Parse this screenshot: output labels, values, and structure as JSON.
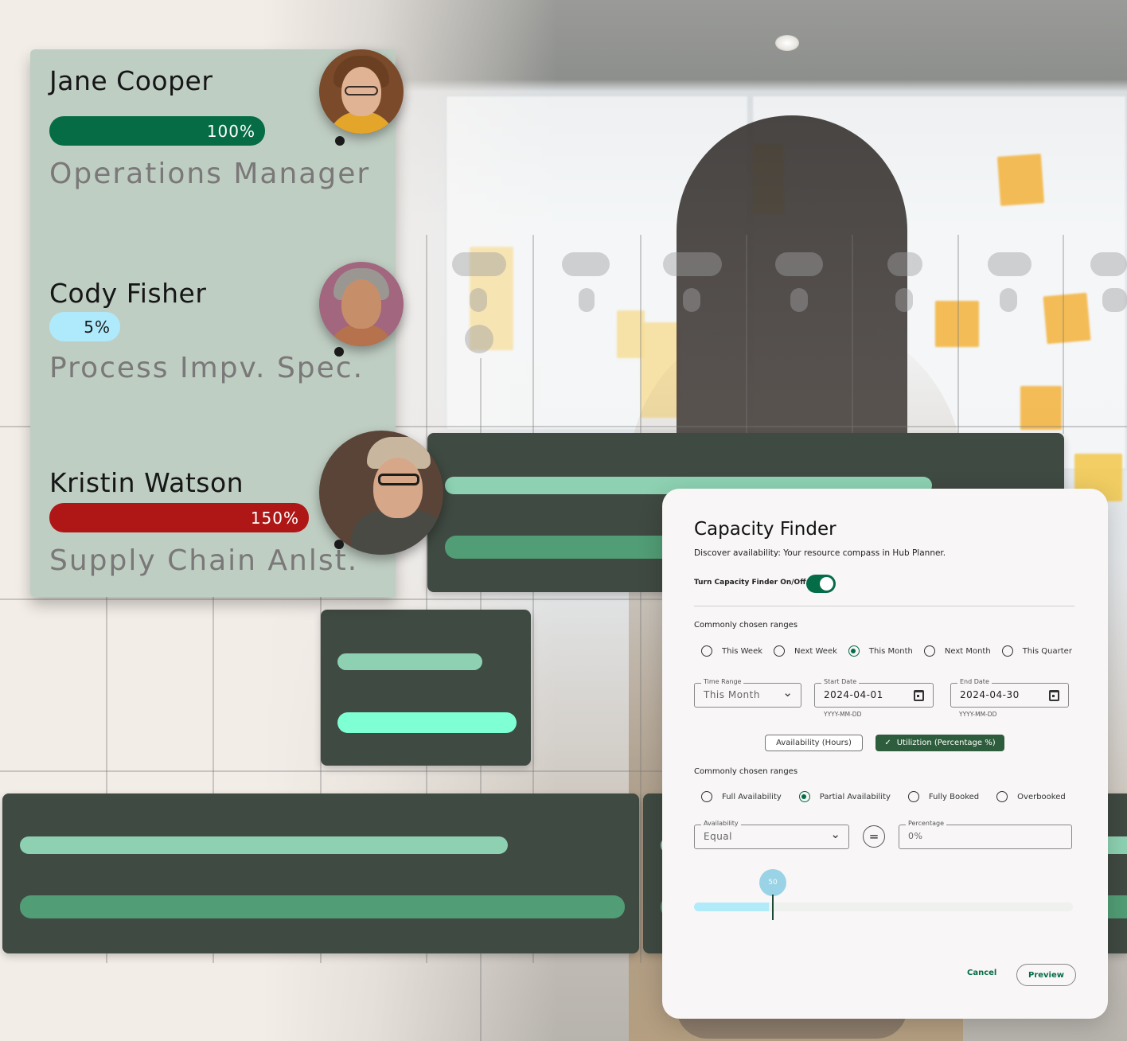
{
  "people": [
    {
      "name": "Jane Cooper",
      "utilization_label": "100%",
      "utilization_pct": 100,
      "role": "Operations Manager",
      "bar_color": "#056c46",
      "avatar": "avatar-jane-cooper"
    },
    {
      "name": "Cody Fisher",
      "utilization_label": "5%",
      "utilization_pct": 5,
      "role": "Process Impv. Spec.",
      "bar_color": "#aeeafc",
      "avatar": "avatar-cody-fisher"
    },
    {
      "name": "Kristin Watson",
      "utilization_label": "150%",
      "utilization_pct": 150,
      "role": "Supply Chain Anlst.",
      "bar_color": "#af1616",
      "avatar": "avatar-kristin-watson"
    }
  ],
  "colors": {
    "card_bg": "#bfcec3",
    "dark_card": "#3f4a42",
    "track_light": "#8dd1b2",
    "track_mid": "#519d75",
    "track_bright": "#7effd4",
    "accent": "#046c47"
  },
  "capacity_finder": {
    "title": "Capacity Finder",
    "subtitle": "Discover availability: Your resource compass in Hub Planner.",
    "toggle_label": "Turn Capacity Finder On/Off",
    "toggle_on": true,
    "ranges_label": "Commonly chosen ranges",
    "ranges": [
      {
        "label": "This Week",
        "selected": false
      },
      {
        "label": "Next Week",
        "selected": false
      },
      {
        "label": "This Month",
        "selected": true
      },
      {
        "label": "Next Month",
        "selected": false
      },
      {
        "label": "This Quarter",
        "selected": false
      }
    ],
    "time_range": {
      "legend": "Time Range",
      "value": "This Month"
    },
    "start_date": {
      "legend": "Start Date",
      "value": "2024-04-01",
      "helper": "YYYY-MM-DD"
    },
    "end_date": {
      "legend": "End Date",
      "value": "2024-04-30",
      "helper": "YYYY-MM-DD"
    },
    "mode_chips": [
      {
        "label": "Availability (Hours)",
        "selected": false
      },
      {
        "label": "Utiliztion (Percentage %)",
        "selected": true
      }
    ],
    "status_label": "Commonly chosen ranges",
    "statuses": [
      {
        "label": "Full Availability",
        "selected": false
      },
      {
        "label": "Partial Availability",
        "selected": true
      },
      {
        "label": "Fully Booked",
        "selected": false
      },
      {
        "label": "Overbooked",
        "selected": false
      }
    ],
    "availability": {
      "legend": "Availability",
      "value": "Equal"
    },
    "operator_symbol": "=",
    "percentage": {
      "legend": "Percentage",
      "placeholder": "0%"
    },
    "slider": {
      "value": 50,
      "min": 0,
      "max": 100,
      "label": "50"
    },
    "cancel_label": "Cancel",
    "preview_label": "Preview"
  },
  "icons": {
    "chevron": "⌄",
    "check": "✓"
  }
}
